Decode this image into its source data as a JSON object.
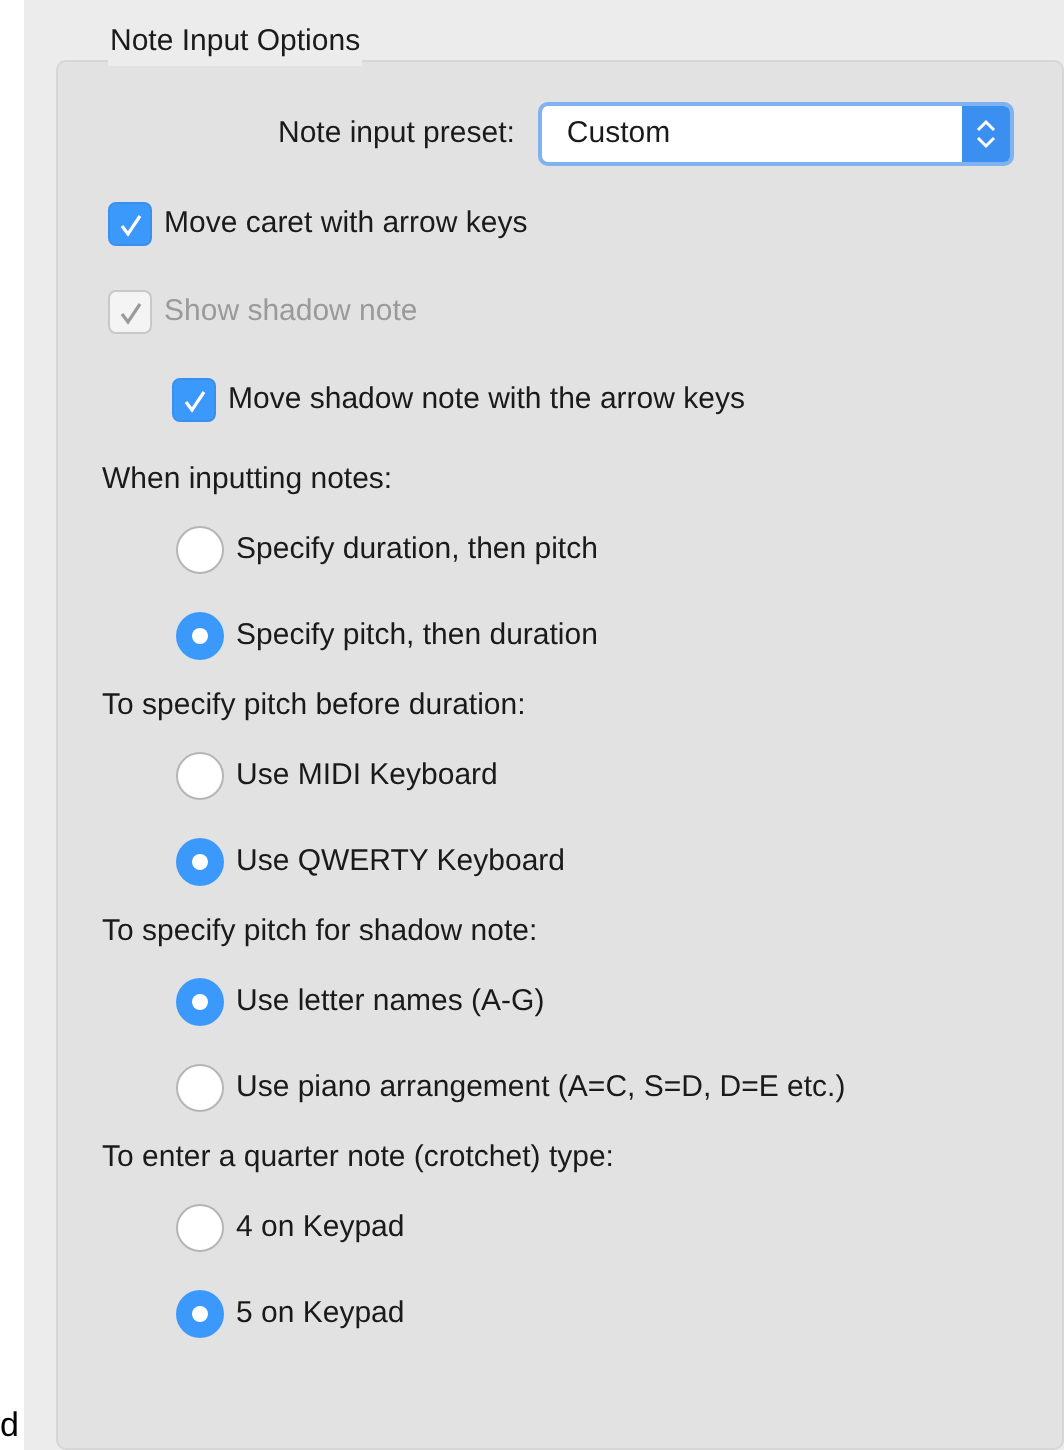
{
  "group": {
    "title": "Note Input Options"
  },
  "preset": {
    "label": "Note input preset:",
    "value": "Custom"
  },
  "checkboxes": [
    {
      "label": "Move caret with arrow keys",
      "checked": true,
      "disabled": false
    },
    {
      "label": "Show shadow note",
      "checked": true,
      "disabled": true,
      "children": [
        {
          "label": "Move shadow note with the arrow keys",
          "checked": true,
          "disabled": false
        }
      ]
    }
  ],
  "sections": [
    {
      "heading": "When inputting notes:",
      "options": [
        {
          "label": "Specify duration, then pitch",
          "selected": false
        },
        {
          "label": "Specify pitch, then duration",
          "selected": true
        }
      ]
    },
    {
      "heading": "To specify pitch before duration:",
      "options": [
        {
          "label": "Use MIDI Keyboard",
          "selected": false
        },
        {
          "label": "Use QWERTY Keyboard",
          "selected": true
        }
      ]
    },
    {
      "heading": "To specify pitch for shadow note:",
      "options": [
        {
          "label": "Use letter names (A-G)",
          "selected": true
        },
        {
          "label": "Use piano arrangement (A=C, S=D, D=E etc.)",
          "selected": false
        }
      ]
    },
    {
      "heading": "To enter a quarter note (crotchet) type:",
      "options": [
        {
          "label": "4 on Keypad",
          "selected": false
        },
        {
          "label": "5 on Keypad",
          "selected": true
        }
      ]
    }
  ],
  "edge_fragment": "d"
}
